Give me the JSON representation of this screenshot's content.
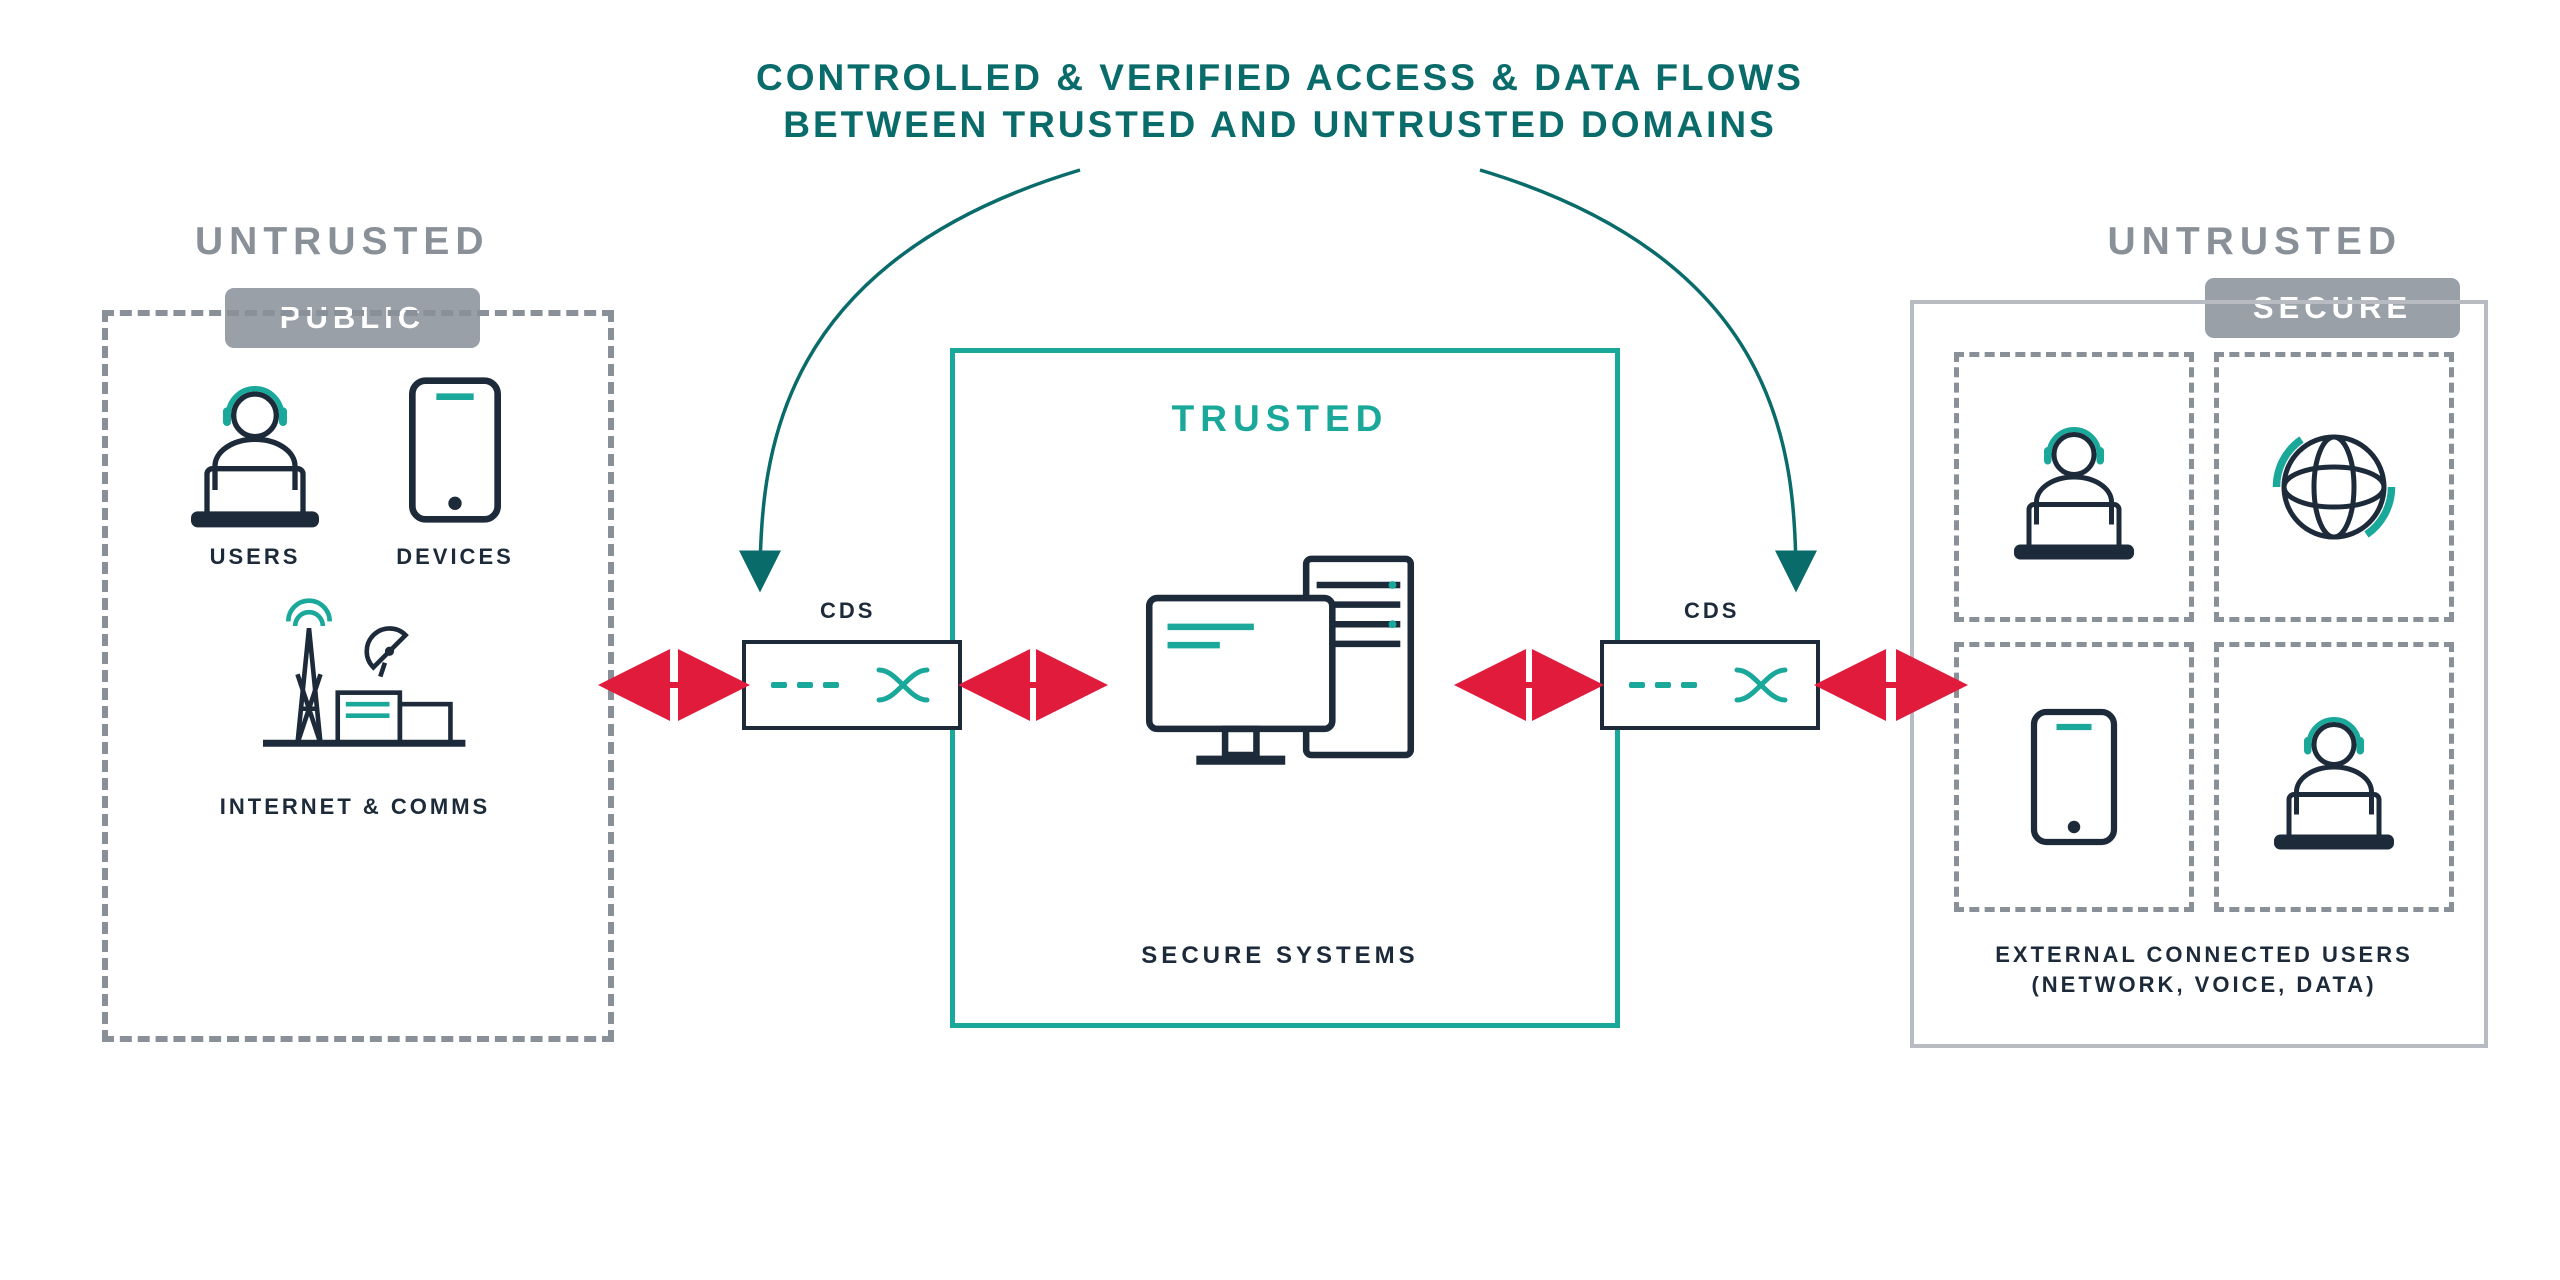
{
  "title_line1": "CONTROLLED & VERIFIED ACCESS & DATA FLOWS",
  "title_line2": "BETWEEN TRUSTED AND UNTRUSTED DOMAINS",
  "untrusted_label": "UNTRUSTED",
  "public": {
    "pill": "PUBLIC",
    "users": "USERS",
    "devices": "DEVICES",
    "internet_comms": "INTERNET & COMMS"
  },
  "trusted": {
    "heading": "TRUSTED",
    "caption": "SECURE SYSTEMS"
  },
  "secure": {
    "pill": "SECURE",
    "caption_line1": "EXTERNAL CONNECTED USERS",
    "caption_line2": "(NETWORK, VOICE, DATA)"
  },
  "cds": {
    "label": "CDS"
  }
}
